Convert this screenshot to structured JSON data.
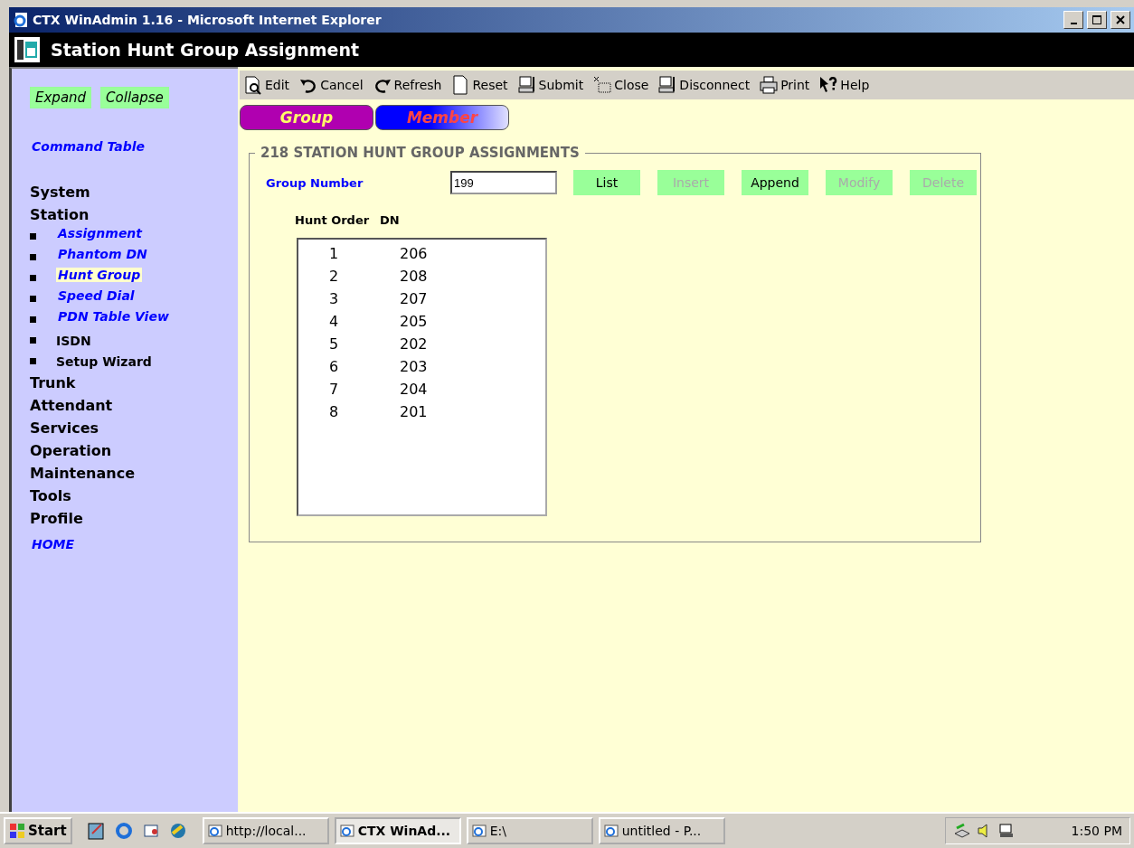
{
  "window": {
    "title": "CTX WinAdmin 1.16 - Microsoft Internet Explorer"
  },
  "app_header": {
    "title": "Station Hunt Group Assignment"
  },
  "sidebar": {
    "buttons": [
      "Expand",
      "Collapse"
    ],
    "command_table": "Command Table",
    "nav": [
      {
        "label": "System"
      },
      {
        "label": "Station",
        "children": [
          {
            "label": "Assignment",
            "kind": "link",
            "selected": false
          },
          {
            "label": "Phantom DN",
            "kind": "link",
            "selected": false
          },
          {
            "label": "Hunt Group",
            "kind": "link",
            "selected": true
          },
          {
            "label": "Speed Dial",
            "kind": "link",
            "selected": false
          },
          {
            "label": "PDN Table View",
            "kind": "link",
            "selected": false
          },
          {
            "label": "ISDN",
            "kind": "plain",
            "selected": false
          },
          {
            "label": "Setup Wizard",
            "kind": "plain",
            "selected": false
          }
        ]
      },
      {
        "label": "Trunk"
      },
      {
        "label": "Attendant"
      },
      {
        "label": "Services"
      },
      {
        "label": "Operation"
      },
      {
        "label": "Maintenance"
      },
      {
        "label": "Tools"
      },
      {
        "label": "Profile"
      }
    ],
    "home": "HOME"
  },
  "toolbar": [
    {
      "label": "Edit",
      "kind": "edit"
    },
    {
      "label": "Cancel",
      "kind": "cancel"
    },
    {
      "label": "Refresh",
      "kind": "refresh"
    },
    {
      "label": "Reset",
      "kind": "reset"
    },
    {
      "label": "Submit",
      "kind": "submit"
    },
    {
      "label": "Close",
      "kind": "close"
    },
    {
      "label": "Disconnect",
      "kind": "disconnect"
    },
    {
      "label": "Print",
      "kind": "print"
    },
    {
      "label": "Help",
      "kind": "help"
    }
  ],
  "tabs": [
    {
      "label": "Group",
      "selected": true
    },
    {
      "label": "Member",
      "selected": false
    }
  ],
  "form": {
    "legend": "218 STATION HUNT GROUP ASSIGNMENTS",
    "group_number_label": "Group Number",
    "group_number": "199",
    "buttons": [
      {
        "label": "List",
        "disabled": false
      },
      {
        "label": "Insert",
        "disabled": true
      },
      {
        "label": "Append",
        "disabled": false
      },
      {
        "label": "Modify",
        "disabled": true
      },
      {
        "label": "Delete",
        "disabled": true
      }
    ],
    "columns": [
      "Hunt Order",
      "DN"
    ],
    "rows": [
      [
        "1",
        "206"
      ],
      [
        "2",
        "208"
      ],
      [
        "3",
        "207"
      ],
      [
        "4",
        "205"
      ],
      [
        "5",
        "202"
      ],
      [
        "6",
        "203"
      ],
      [
        "7",
        "204"
      ],
      [
        "8",
        "201"
      ]
    ]
  },
  "taskbar": {
    "start": "Start",
    "tasks": [
      {
        "label": "http://local...",
        "selected": false
      },
      {
        "label": "CTX WinAd...",
        "selected": true
      },
      {
        "label": "E:\\",
        "selected": false
      },
      {
        "label": "untitled - P...",
        "selected": false
      }
    ],
    "clock": "1:50 PM"
  }
}
